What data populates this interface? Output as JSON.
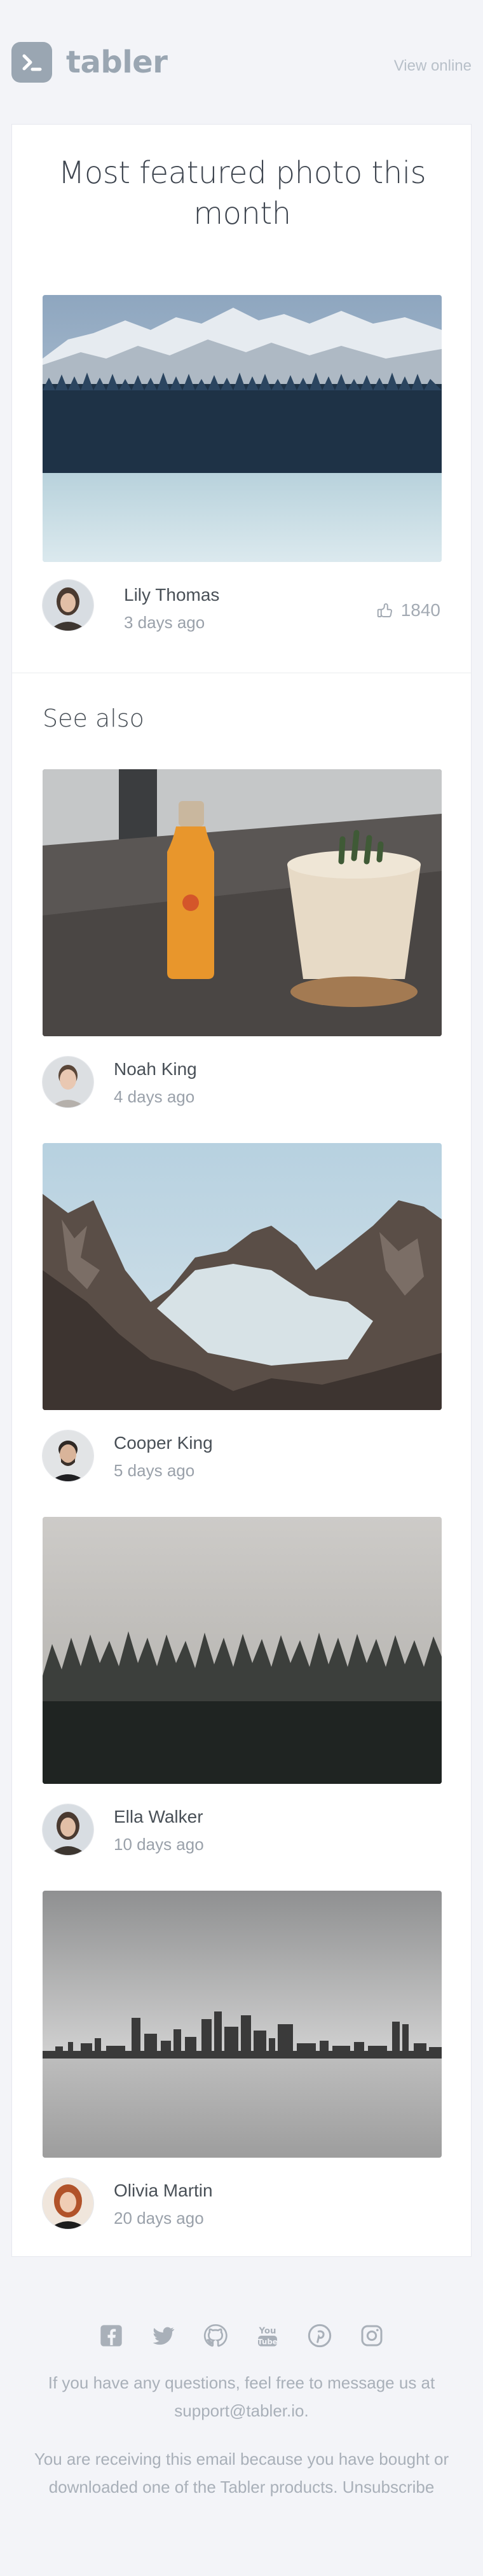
{
  "header": {
    "logo_text": "tabler",
    "view_online": "View online"
  },
  "featured": {
    "title": "Most featured photo this month",
    "photo_subject": "snowy mountains above a frozen lake and pine forest",
    "author": {
      "name": "Lily Thomas",
      "date": "3 days ago"
    },
    "likes": "1840"
  },
  "see_also": {
    "heading": "See also",
    "items": [
      {
        "photo_subject": "orange juice bottle and cactus pot on a table",
        "name": "Noah King",
        "date": "4 days ago"
      },
      {
        "photo_subject": "rocky snow mountains under blue sky",
        "name": "Cooper King",
        "date": "5 days ago"
      },
      {
        "photo_subject": "foggy dark pine forest",
        "name": "Ella Walker",
        "date": "10 days ago"
      },
      {
        "photo_subject": "black and white city skyline over water",
        "name": "Olivia Martin",
        "date": "20 days ago"
      }
    ]
  },
  "footer": {
    "social_icons": [
      "facebook-icon",
      "twitter-icon",
      "github-icon",
      "youtube-icon",
      "pinterest-icon",
      "instagram-icon"
    ],
    "question_text": "If you have any questions, feel free to message us at",
    "support_email": "support@tabler.io.",
    "notice_text": "You are receiving this email because you have bought or downloaded one of the Tabler products.",
    "unsubscribe": "Unsubscribe"
  },
  "colors": {
    "background": "#f3f4f8",
    "logo": "#9aa6b2",
    "muted_text": "#9aa1aa"
  }
}
